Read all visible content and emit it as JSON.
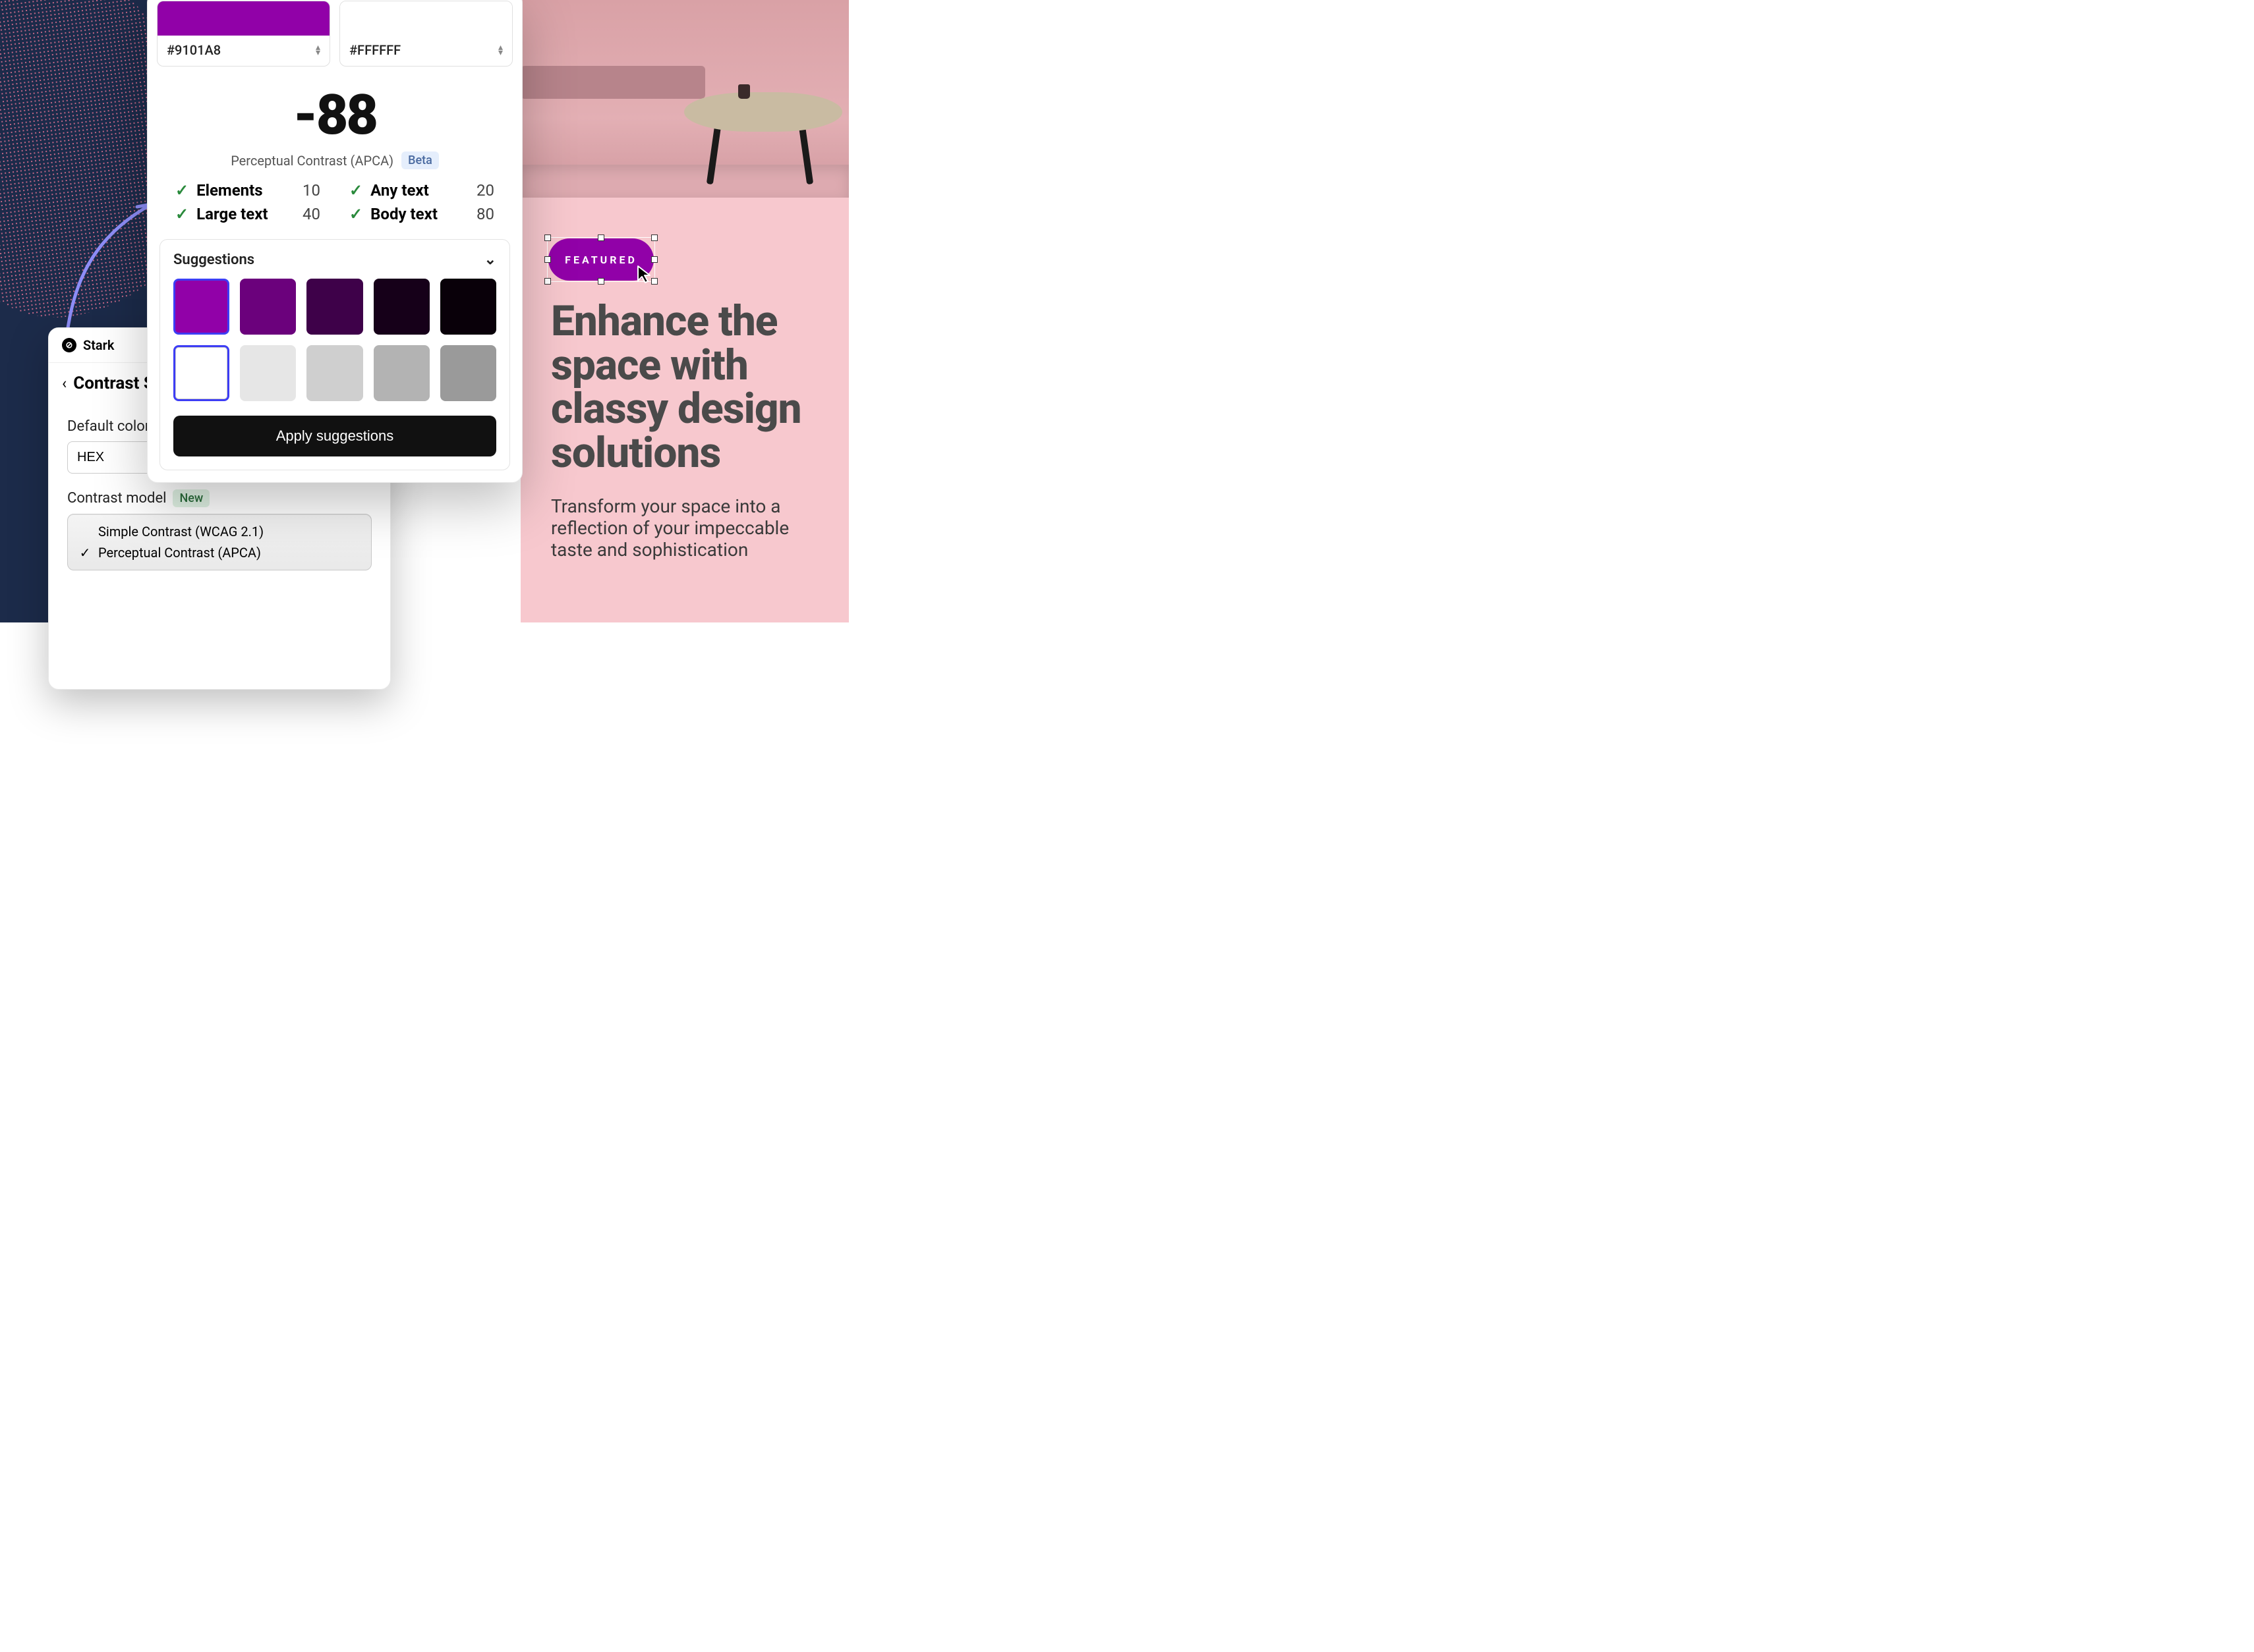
{
  "colors": {
    "foreground_hex": "#9101A8",
    "background_hex": "#FFFFFF"
  },
  "score": {
    "value": "-88",
    "label": "Perceptual Contrast (APCA)",
    "badge": "Beta"
  },
  "checks": [
    {
      "name": "Elements",
      "value": "10",
      "pass": true
    },
    {
      "name": "Any text",
      "value": "20",
      "pass": true
    },
    {
      "name": "Large text",
      "value": "40",
      "pass": true
    },
    {
      "name": "Body text",
      "value": "80",
      "pass": true
    }
  ],
  "suggestions": {
    "title": "Suggestions",
    "rowA": [
      "#9101A8",
      "#6b017c",
      "#3e0149",
      "#160019",
      "#090009"
    ],
    "rowB": [
      "#ffffff",
      "#e6e6e6",
      "#cfcfcf",
      "#b3b3b3",
      "#9a9a9a"
    ],
    "selectedA": 0,
    "selectedB": 0,
    "apply_label": "Apply suggestions"
  },
  "settings_panel": {
    "brand": "Stark",
    "nav_title": "Contrast S",
    "default_color_label": "Default color",
    "default_color_format": "HEX",
    "contrast_model_label": "Contrast model",
    "contrast_model_badge": "New",
    "options": [
      {
        "label": "Simple Contrast (WCAG 2.1)",
        "selected": false
      },
      {
        "label": "Perceptual Contrast (APCA)",
        "selected": true
      }
    ]
  },
  "design": {
    "pill_label": "FEATURED",
    "headline": "Enhance the space with classy design solutions",
    "subhead": "Transform your space into a reflection of your impeccable taste and sophistication"
  }
}
